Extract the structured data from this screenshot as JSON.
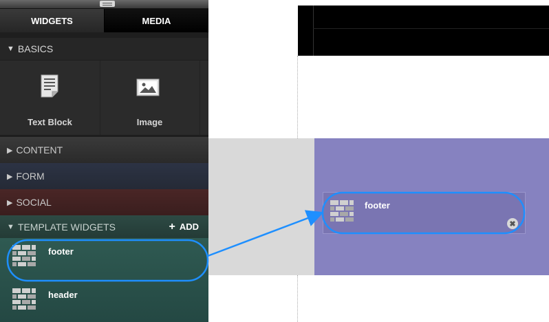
{
  "sidebar": {
    "tabs": [
      {
        "label": "WIDGETS",
        "active": true
      },
      {
        "label": "MEDIA",
        "active": false
      }
    ],
    "basics": {
      "label": "BASICS",
      "expanded": true,
      "widgets": [
        {
          "label": "Text Block",
          "icon": "text-block-icon"
        },
        {
          "label": "Image",
          "icon": "image-icon"
        }
      ]
    },
    "sections": [
      {
        "label": "CONTENT",
        "expanded": false
      },
      {
        "label": "FORM",
        "expanded": false
      },
      {
        "label": "SOCIAL",
        "expanded": false
      }
    ],
    "template_widgets": {
      "label": "TEMPLATE WIDGETS",
      "expanded": true,
      "add_label": "ADD",
      "items": [
        {
          "label": "footer",
          "icon": "template-widget-icon"
        },
        {
          "label": "header",
          "icon": "template-widget-icon"
        }
      ]
    }
  },
  "canvas": {
    "placed_widget": {
      "label": "footer",
      "icon": "template-widget-icon"
    }
  },
  "colors": {
    "highlight": "#1e8fff",
    "drop_zone": "#8682c0",
    "template_bg": "#2f5a52"
  }
}
